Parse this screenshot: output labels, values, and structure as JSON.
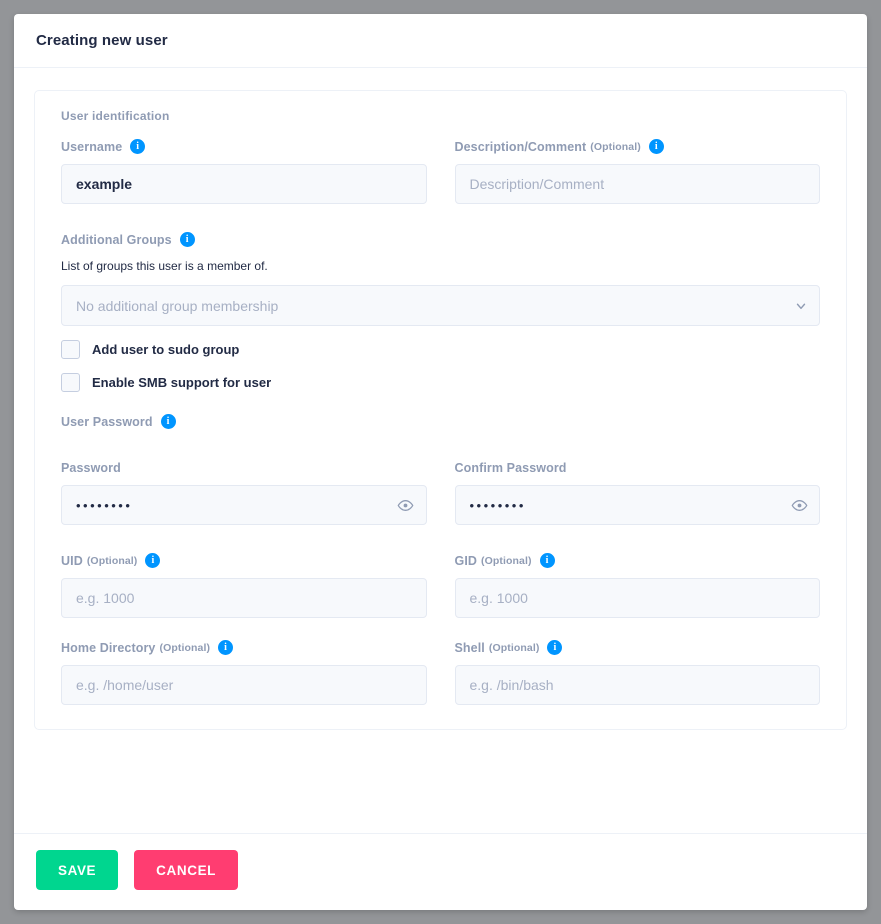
{
  "header": {
    "title": "Creating new user"
  },
  "colors": {
    "page_background": "#939598",
    "accent_info": "#0095ff",
    "label": "#8f9bb3",
    "text": "#222b45",
    "save": "#00d68f",
    "cancel": "#ff3d71",
    "input_background": "#f7f9fc",
    "input_border": "#e4e9f2"
  },
  "form": {
    "section_user_identification": "User identification",
    "username": {
      "label": "Username",
      "value": "example",
      "info_icon": "info-icon"
    },
    "description": {
      "label": "Description/Comment",
      "optional": "(Optional)",
      "placeholder": "Description/Comment",
      "value": "",
      "info_icon": "info-icon"
    },
    "additional_groups": {
      "label": "Additional Groups",
      "info_icon": "info-icon",
      "helper": "List of groups this user is a member of.",
      "selected": "No additional group membership",
      "chevron_icon": "chevron-down-icon"
    },
    "checkbox_sudo": {
      "label": "Add user to sudo group",
      "checked": false
    },
    "checkbox_smb": {
      "label": "Enable SMB support for user",
      "checked": false
    },
    "section_user_password": {
      "label": "User Password",
      "info_icon": "info-icon"
    },
    "password": {
      "label": "Password",
      "value": "••••••••",
      "reveal_icon": "eye-icon"
    },
    "confirm_password": {
      "label": "Confirm Password",
      "value": "••••••••",
      "reveal_icon": "eye-icon"
    },
    "uid": {
      "label": "UID",
      "optional": "(Optional)",
      "placeholder": "e.g. 1000",
      "value": "",
      "info_icon": "info-icon"
    },
    "gid": {
      "label": "GID",
      "optional": "(Optional)",
      "placeholder": "e.g. 1000",
      "value": "",
      "info_icon": "info-icon"
    },
    "home_directory": {
      "label": "Home Directory",
      "optional": "(Optional)",
      "placeholder": "e.g. /home/user",
      "value": "",
      "info_icon": "info-icon"
    },
    "shell": {
      "label": "Shell",
      "optional": "(Optional)",
      "placeholder": "e.g. /bin/bash",
      "value": "",
      "info_icon": "info-icon"
    }
  },
  "footer": {
    "save_label": "SAVE",
    "cancel_label": "CANCEL"
  }
}
